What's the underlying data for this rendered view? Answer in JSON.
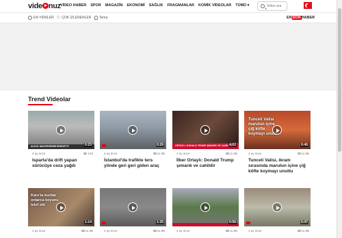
{
  "header": {
    "logo": "videonuz",
    "nav": [
      "VİDEO HABER",
      "SPOR",
      "MAGAZİN",
      "EKONOMİ",
      "SAĞLIK",
      "FRAGMANLAR",
      "KOMİK VİDEOLAR",
      "TÜMÜ ▾"
    ],
    "search_placeholder": "Video ara"
  },
  "subnav": {
    "items": [
      "EN YENİLER",
      "ÇOK İZLENENLER",
      "Tema"
    ],
    "sonhaber_a": "EN",
    "sonhaber_b": "SON",
    "sonhaber_c": "HABER"
  },
  "section": {
    "title": "Trend Videolar"
  },
  "videos": [
    {
      "title": "Isparta'da drift yapan sürücüye ceza yağdı",
      "age": "4 ay önce",
      "views": "129",
      "duration": "0:23",
      "caption": "ALKOL MUAYENESİNİ REDDETTİ"
    },
    {
      "title": "İstanbul'da trafikte ters yönde geri geri giden araç",
      "age": "4 ay önce",
      "views": "11.9B",
      "duration": "0:26",
      "caption": ""
    },
    {
      "title": "İlber Ortaylı: Donald Trump şımarık ve cahildir",
      "age": "4 ay önce",
      "views": "11.9B",
      "duration": "4:02",
      "caption": "ORTAYLI: DONALD TRUMP ŞIMARIK VE CAHİLDİR"
    },
    {
      "title": "Tunceli Valisi, ikram sırasında marulun içine çiğ köfte koymayı unuttu",
      "age": "4 ay önce",
      "views": "11.9B",
      "duration": "0:46",
      "caption": "Tunceli Valisi marulun içine çiğ köfte koymayı unuttu"
    },
    {
      "title": "",
      "age": "4 ay önce",
      "views": "11.9B",
      "duration": "1:14",
      "caption": "Kars'ta kurtlar onlarca koyunu telef etti"
    },
    {
      "title": "",
      "age": "4 ay önce",
      "views": "11.9B",
      "duration": "1:35",
      "caption": ""
    },
    {
      "title": "",
      "age": "4 ay önce",
      "views": "11.9B",
      "duration": "0:56",
      "caption": ""
    },
    {
      "title": "",
      "age": "4 ay önce",
      "views": "11.9B",
      "duration": "0:47",
      "caption": ""
    }
  ]
}
